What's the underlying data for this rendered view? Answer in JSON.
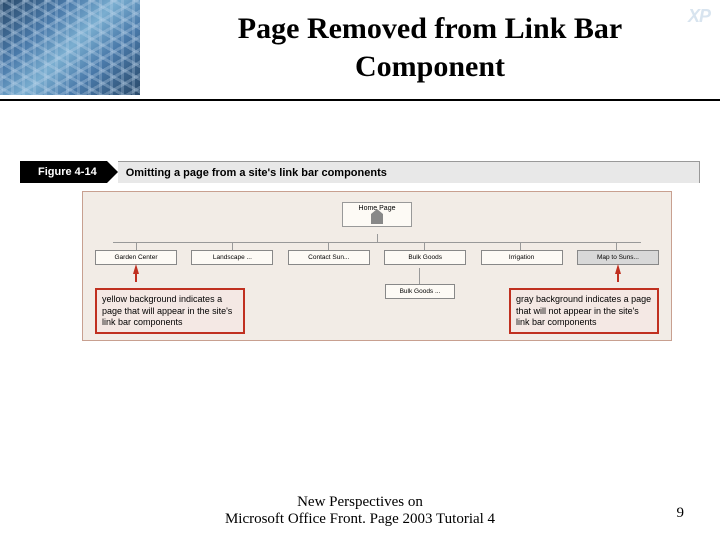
{
  "header": {
    "title_line1": "Page Removed from Link Bar",
    "title_line2": "Component",
    "badge": "XP"
  },
  "figure": {
    "number": "Figure 4-14",
    "caption": "Omitting a page from a site's link bar components",
    "home_label": "Home Page",
    "children": [
      {
        "label": "Garden Center",
        "gray": false,
        "arrow": true
      },
      {
        "label": "Landscape ...",
        "gray": false,
        "arrow": false
      },
      {
        "label": "Contact Sun...",
        "gray": false,
        "arrow": false
      },
      {
        "label": "Bulk Goods",
        "gray": false,
        "arrow": false
      },
      {
        "label": "Irrigation",
        "gray": false,
        "arrow": false
      },
      {
        "label": "Map to Suns...",
        "gray": true,
        "arrow": true
      }
    ],
    "subchild": "Bulk Goods ...",
    "callout_left": "yellow background indicates a page that will appear in the site's link bar components",
    "callout_right": "gray background indicates a page that will not appear in the site's link bar components"
  },
  "footer": {
    "line1": "New Perspectives on",
    "line2": "Microsoft Office Front. Page 2003 Tutorial 4",
    "page": "9"
  }
}
